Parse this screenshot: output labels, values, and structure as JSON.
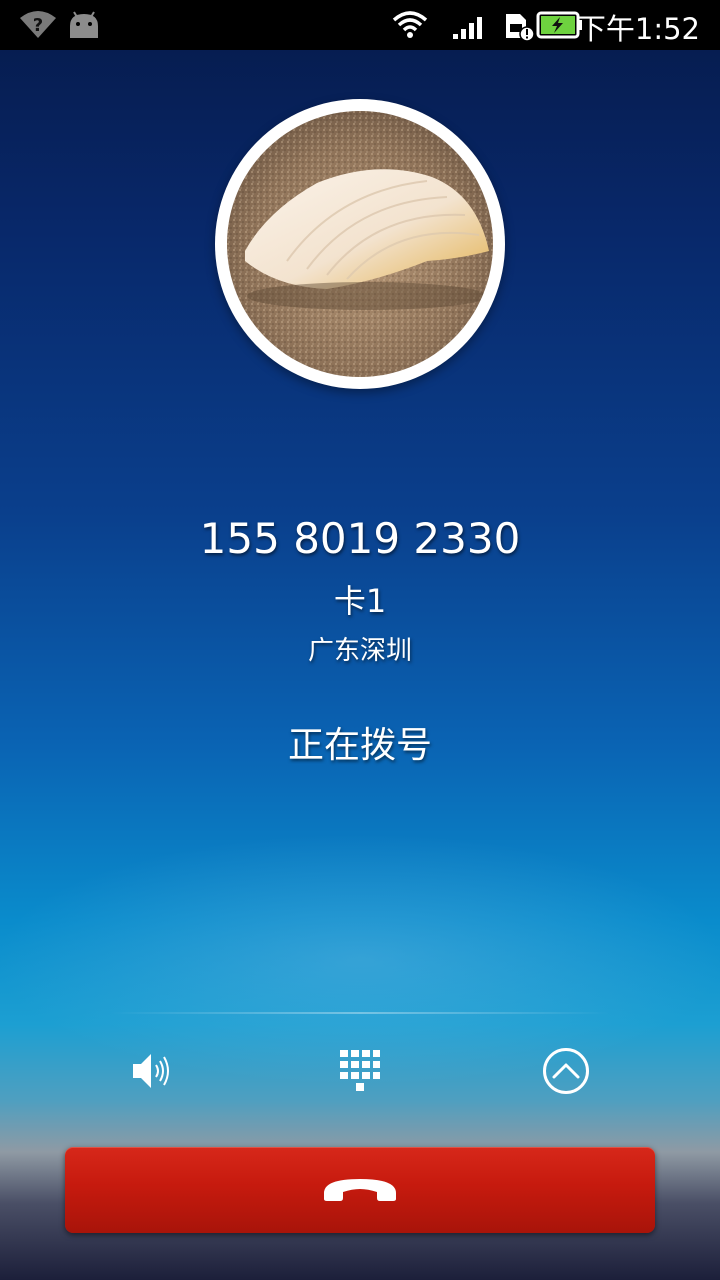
{
  "status_bar": {
    "time": "下午1:52",
    "icons": [
      "wifi-unknown-icon",
      "android-debug-icon",
      "wifi-icon",
      "cell-signal-icon",
      "sim-alert-icon",
      "battery-charging-icon"
    ],
    "battery_color": "#6ed23f"
  },
  "call": {
    "number": "155 8019 2330",
    "sim": "卡1",
    "location": "广东深圳",
    "state": "正在拨号"
  },
  "controls": {
    "speaker_icon": "speaker-icon",
    "dialpad_icon": "dialpad-icon",
    "expand_icon": "expand-up-icon",
    "end_call_icon": "hang-up-icon",
    "end_call_color": "#c61a0e"
  }
}
